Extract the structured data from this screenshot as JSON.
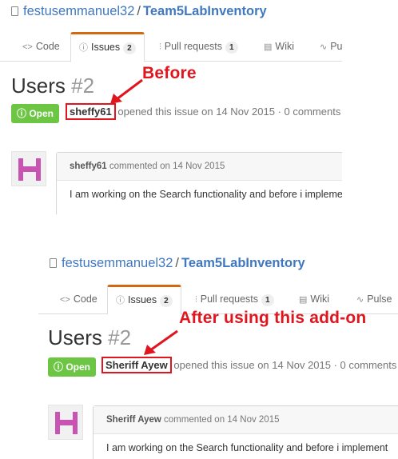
{
  "before": {
    "repo_owner": "festusemmanuel32",
    "repo_sep": "/",
    "repo_name": "Team5LabInventory",
    "tabs": {
      "code": "Code",
      "issues": "Issues",
      "issues_count": "2",
      "pulls": "Pull requests",
      "pulls_count": "1",
      "wiki": "Wiki",
      "pulse": "Pulse"
    },
    "issue_title": "Users",
    "issue_number": "#2",
    "state": "Open",
    "author": "sheffy61",
    "meta_text": "opened this issue on 14 Nov 2015 · 0 comments",
    "comment_author": "sheffy61",
    "comment_meta": "commented on 14 Nov 2015",
    "comment_body": "I am working on the Search functionality and before i implement"
  },
  "after": {
    "repo_owner": "festusemmanuel32",
    "repo_sep": "/",
    "repo_name": "Team5LabInventory",
    "tabs": {
      "code": "Code",
      "issues": "Issues",
      "issues_count": "2",
      "pulls": "Pull requests",
      "pulls_count": "1",
      "wiki": "Wiki",
      "pulse": "Pulse"
    },
    "issue_title": "Users",
    "issue_number": "#2",
    "state": "Open",
    "author": "Sheriff Ayew",
    "meta_text": "opened this issue on 14 Nov 2015 · 0 comments",
    "comment_author": "Sheriff Ayew",
    "comment_meta": "commented on 14 Nov 2015",
    "comment_body": "I am working on the Search functionality and before i implement"
  },
  "callouts": {
    "before": "Before",
    "after": "After using this add-on"
  },
  "colors": {
    "accent": "#e0161f",
    "open": "#6cc644",
    "link": "#4078c0",
    "tab_active": "#d26911",
    "avatar": "#c953b3"
  },
  "icons": [
    "book-icon",
    "code-icon",
    "issue-opened-icon",
    "pull-request-icon",
    "wiki-icon",
    "pulse-icon"
  ]
}
